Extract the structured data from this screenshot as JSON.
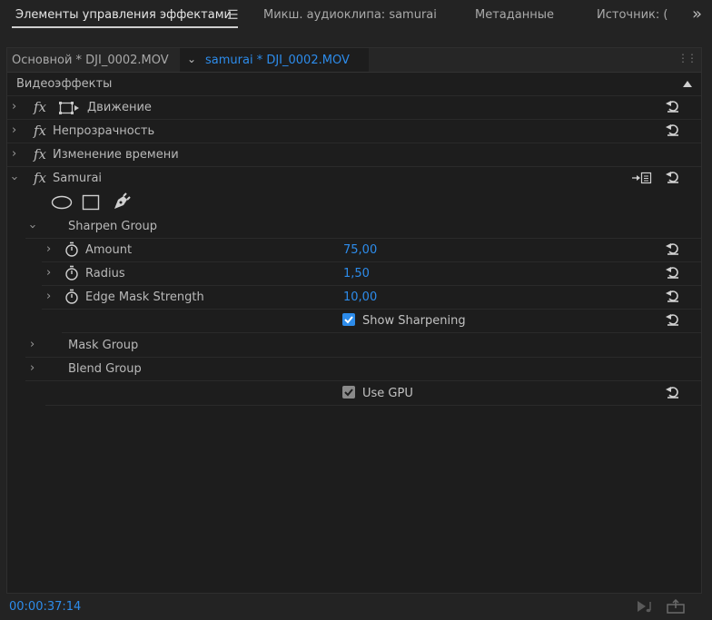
{
  "tabs": [
    {
      "label": "Элементы управления эффектами"
    },
    {
      "label": "Микш. аудиоклипа: samurai"
    },
    {
      "label": "Метаданные"
    },
    {
      "label": "Источник: ("
    }
  ],
  "clipbar": {
    "master_clip": "Основной * DJI_0002.MOV",
    "active_clip": "samurai * DJI_0002.MOV"
  },
  "section_title": "Видеоэффекты",
  "effects": {
    "motion": "Движение",
    "opacity": "Непрозрачность",
    "time_remap": "Изменение времени",
    "samurai": "Samurai"
  },
  "groups": {
    "sharpen": "Sharpen Group",
    "mask": "Mask Group",
    "blend": "Blend Group"
  },
  "params": [
    {
      "label": "Amount",
      "value": "75,00"
    },
    {
      "label": "Radius",
      "value": "1,50"
    },
    {
      "label": "Edge Mask Strength",
      "value": "10,00"
    }
  ],
  "checkboxes": {
    "show_sharpening": {
      "label": "Show Sharpening",
      "checked": true
    },
    "use_gpu": {
      "label": "Use GPU",
      "checked": true
    }
  },
  "timecode": "00:00:37:14",
  "colors": {
    "accent": "#2d8ceb",
    "panel_bg": "#1d1d1d",
    "checkbox_on": "#2d8ceb",
    "checkbox_gpu": "#8a8a8a"
  }
}
